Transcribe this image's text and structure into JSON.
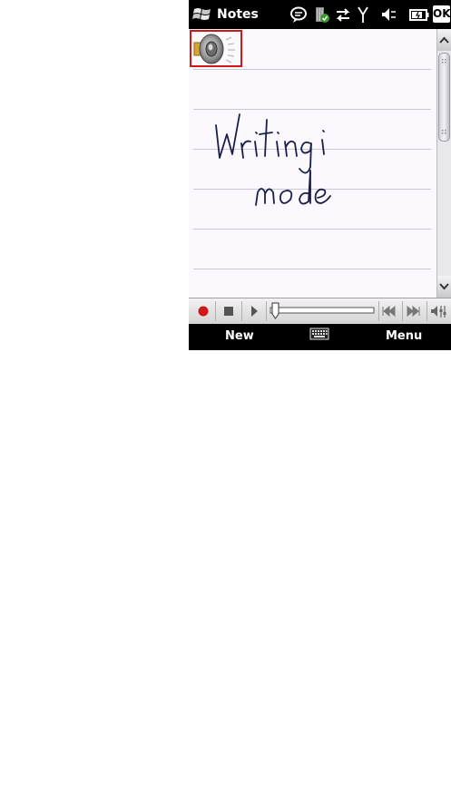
{
  "titlebar": {
    "title": "Notes",
    "ok_label": "OK",
    "icons": [
      "start-flag-icon",
      "notification-bubble-icon",
      "sim-data-icon",
      "connectivity-icon",
      "signal-icon",
      "volume-muted-icon",
      "battery-icon"
    ]
  },
  "note": {
    "attachment_icon": "speaker-icon",
    "handwriting": [
      "Writing",
      "mode"
    ],
    "ink_color": "#1a1f4a"
  },
  "recorder": {
    "buttons": [
      "record-icon",
      "stop-icon",
      "play-icon",
      "skip-back-icon",
      "skip-forward-icon",
      "volume-icon"
    ],
    "record_color": "#d01818",
    "position": 0
  },
  "softkeys": {
    "left": "New",
    "center_icon": "keyboard-icon",
    "right": "Menu"
  }
}
